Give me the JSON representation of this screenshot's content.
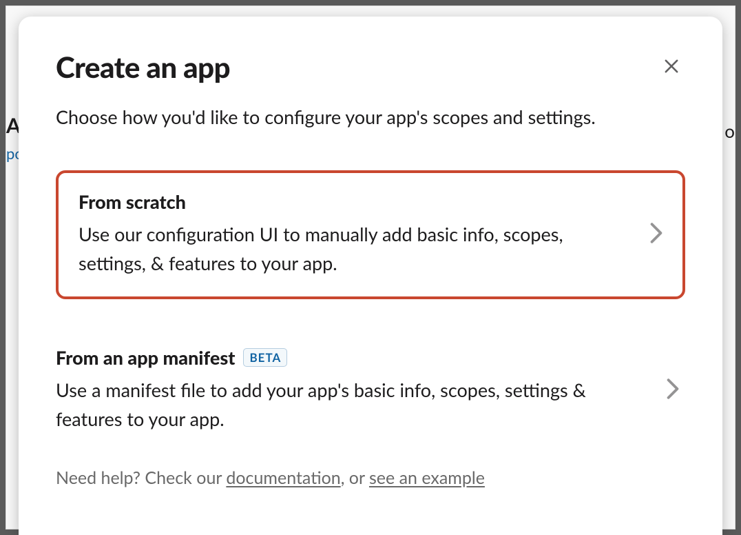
{
  "backdrop": {
    "left_fragment": "A",
    "right_fragment": "o",
    "link_fragment": "po"
  },
  "modal": {
    "title": "Create an app",
    "subtitle": "Choose how you'd like to configure your app's scopes and settings.",
    "options": [
      {
        "title": "From scratch",
        "description": "Use our configuration UI to manually add basic info, scopes, settings, & features to your app.",
        "badge": null,
        "highlighted": true
      },
      {
        "title": "From an app manifest",
        "description": "Use a manifest file to add your app's basic info, scopes, settings & features to your app.",
        "badge": "BETA",
        "highlighted": false
      }
    ],
    "help": {
      "prefix": "Need help? Check our ",
      "link1": "documentation",
      "middle": ", or ",
      "link2": "see an example"
    }
  }
}
